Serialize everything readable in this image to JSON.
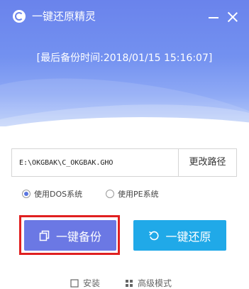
{
  "app": {
    "title": "一键还原精灵"
  },
  "status": {
    "last_backup": "[最后备份时间:2018/01/15 15:16:07]"
  },
  "path": {
    "value": "E:\\OKGBAK\\C_OKGBAK.GHO",
    "change_label": "更改路径"
  },
  "modes": [
    {
      "label": "使用DOS系统",
      "checked": true
    },
    {
      "label": "使用PE系统",
      "checked": false
    }
  ],
  "actions": {
    "backup_label": "一键备份",
    "restore_label": "一键还原"
  },
  "footer": {
    "install_label": "安装",
    "advanced_label": "高级模式"
  },
  "colors": {
    "header_top": "#6a83ec",
    "backup": "#6b78e4",
    "restore": "#20a9e8",
    "highlight": "#e02020"
  }
}
